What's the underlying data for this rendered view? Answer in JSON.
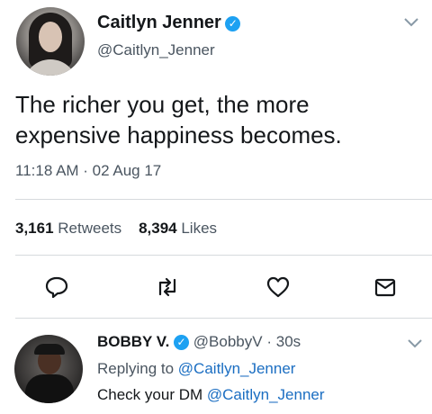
{
  "tweet": {
    "display_name": "Caitlyn Jenner",
    "handle": "@Caitlyn_Jenner",
    "text": "The richer you get, the more expensive happiness becomes.",
    "timestamp": "11:18 AM · 02 Aug 17",
    "retweets_count": "3,161",
    "retweets_label": "Retweets",
    "likes_count": "8,394",
    "likes_label": "Likes"
  },
  "reply": {
    "display_name": "BOBBY V.",
    "handle": "@BobbyV",
    "separator": "·",
    "time": "30s",
    "replying_prefix": "Replying to",
    "replying_to": "@Caitlyn_Jenner",
    "text": "Check your DM",
    "mention": "@Caitlyn_Jenner"
  },
  "icons": {
    "verified": "verified-badge-icon",
    "reply": "reply-icon",
    "retweet": "retweet-icon",
    "like": "heart-icon",
    "dm": "envelope-icon",
    "more": "chevron-down-icon"
  },
  "colors": {
    "verified": "#1da1f2",
    "link": "#1b6ec2",
    "secondary_text": "#4a5560"
  }
}
